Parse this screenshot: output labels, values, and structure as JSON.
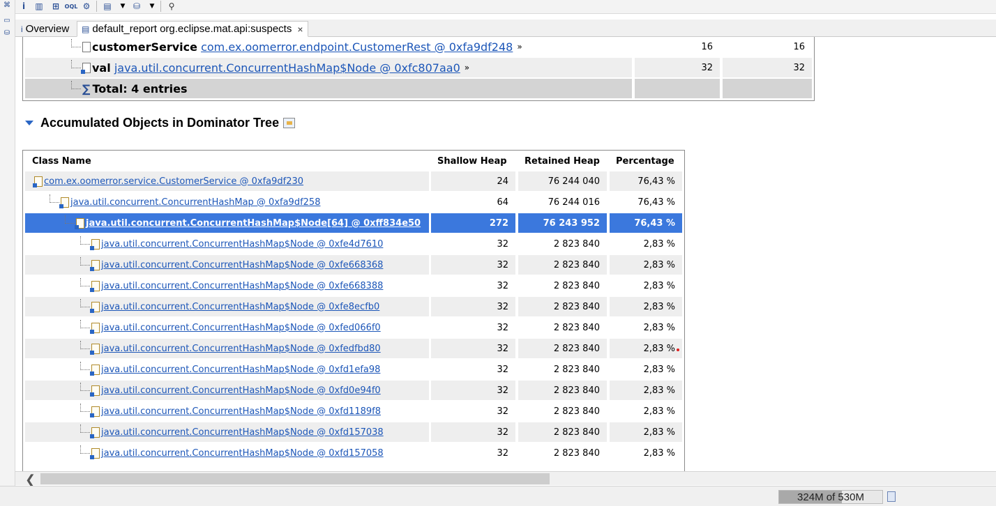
{
  "tabs": {
    "overview": "Overview",
    "report": "default_report org.eclipse.mat.api:suspects",
    "close": "×"
  },
  "table1": {
    "rows": [
      {
        "field": "customerService",
        "ref": "com.ex.oomerror.endpoint.CustomerRest @ 0xfa9df248",
        "more": "»",
        "shallow": "16",
        "retained": "16"
      },
      {
        "field": "val",
        "ref": "java.util.concurrent.ConcurrentHashMap$Node @ 0xfc807aa0",
        "more": "»",
        "shallow": "32",
        "retained": "32"
      }
    ],
    "total": "Total: 4 entries"
  },
  "section": {
    "title": "Accumulated Objects in Dominator Tree"
  },
  "table2": {
    "headers": {
      "class_name": "Class Name",
      "shallow": "Shallow Heap",
      "retained": "Retained Heap",
      "percentage": "Percentage"
    },
    "rows": [
      {
        "name": "com.ex.oomerror.service.CustomerService @ 0xfa9df230",
        "shallow": "24",
        "retained": "76 244 040",
        "pct": "76,43 %"
      },
      {
        "name": "java.util.concurrent.ConcurrentHashMap @ 0xfa9df258",
        "shallow": "64",
        "retained": "76 244 016",
        "pct": "76,43 %"
      },
      {
        "name": "java.util.concurrent.ConcurrentHashMap$Node[64] @ 0xff834e50",
        "shallow": "272",
        "retained": "76 243 952",
        "pct": "76,43 %"
      },
      {
        "name": "java.util.concurrent.ConcurrentHashMap$Node @ 0xfe4d7610",
        "shallow": "32",
        "retained": "2 823 840",
        "pct": "2,83 %"
      },
      {
        "name": "java.util.concurrent.ConcurrentHashMap$Node @ 0xfe668368",
        "shallow": "32",
        "retained": "2 823 840",
        "pct": "2,83 %"
      },
      {
        "name": "java.util.concurrent.ConcurrentHashMap$Node @ 0xfe668388",
        "shallow": "32",
        "retained": "2 823 840",
        "pct": "2,83 %"
      },
      {
        "name": "java.util.concurrent.ConcurrentHashMap$Node @ 0xfe8ecfb0",
        "shallow": "32",
        "retained": "2 823 840",
        "pct": "2,83 %"
      },
      {
        "name": "java.util.concurrent.ConcurrentHashMap$Node @ 0xfed066f0",
        "shallow": "32",
        "retained": "2 823 840",
        "pct": "2,83 %"
      },
      {
        "name": "java.util.concurrent.ConcurrentHashMap$Node @ 0xfedfbd80",
        "shallow": "32",
        "retained": "2 823 840",
        "pct": "2,83 %"
      },
      {
        "name": "java.util.concurrent.ConcurrentHashMap$Node @ 0xfd1efa98",
        "shallow": "32",
        "retained": "2 823 840",
        "pct": "2,83 %"
      },
      {
        "name": "java.util.concurrent.ConcurrentHashMap$Node @ 0xfd0e94f0",
        "shallow": "32",
        "retained": "2 823 840",
        "pct": "2,83 %"
      },
      {
        "name": "java.util.concurrent.ConcurrentHashMap$Node @ 0xfd1189f8",
        "shallow": "32",
        "retained": "2 823 840",
        "pct": "2,83 %"
      },
      {
        "name": "java.util.concurrent.ConcurrentHashMap$Node @ 0xfd157038",
        "shallow": "32",
        "retained": "2 823 840",
        "pct": "2,83 %"
      },
      {
        "name": "java.util.concurrent.ConcurrentHashMap$Node @ 0xfd157058",
        "shallow": "32",
        "retained": "2 823 840",
        "pct": "2,83 %"
      }
    ]
  },
  "status": {
    "heap_label": "324M of 530M",
    "heap_used_fraction": 0.61
  },
  "icons": {
    "toolbar": [
      "info-icon",
      "histogram-icon",
      "dominator-tree-icon",
      "oql-icon",
      "thread-icon",
      "query-browser-icon",
      "dropdown-arrow-icon",
      "heap-dump-icon",
      "dropdown-arrow-icon",
      "search-icon"
    ]
  }
}
